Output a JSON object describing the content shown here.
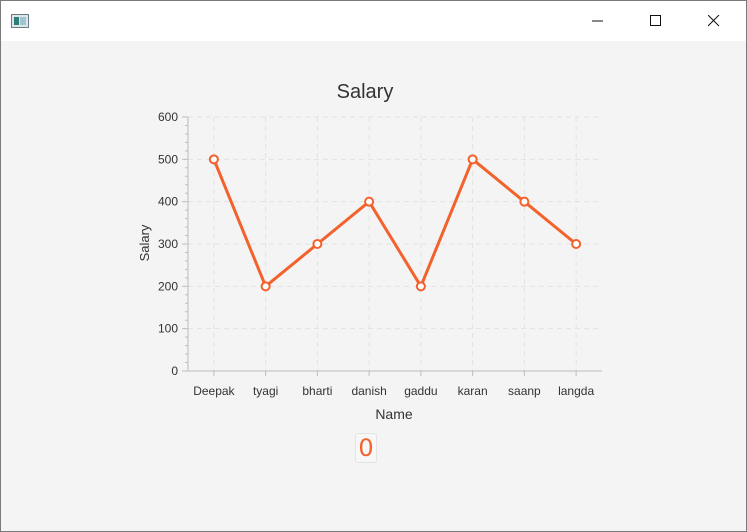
{
  "window": {
    "controls": {
      "minimize_icon": "minimize-icon",
      "maximize_icon": "maximize-icon",
      "close_icon": "close-icon"
    }
  },
  "colors": {
    "series": "#f3622d",
    "grid": "#e2e2e2",
    "axis": "#bdbdbd",
    "text": "#333333"
  },
  "counter": {
    "value": "0"
  },
  "chart_data": {
    "type": "line",
    "title": "Salary",
    "xlabel": "Name",
    "ylabel": "Salary",
    "categories": [
      "Deepak",
      "tyagi",
      "bharti",
      "danish",
      "gaddu",
      "karan",
      "saanp",
      "langda"
    ],
    "values": [
      500,
      200,
      300,
      400,
      200,
      500,
      400,
      300
    ],
    "ylim": [
      0,
      600
    ],
    "yticks": [
      0,
      100,
      200,
      300,
      400,
      500,
      600
    ],
    "grid": true,
    "legend": "none"
  }
}
